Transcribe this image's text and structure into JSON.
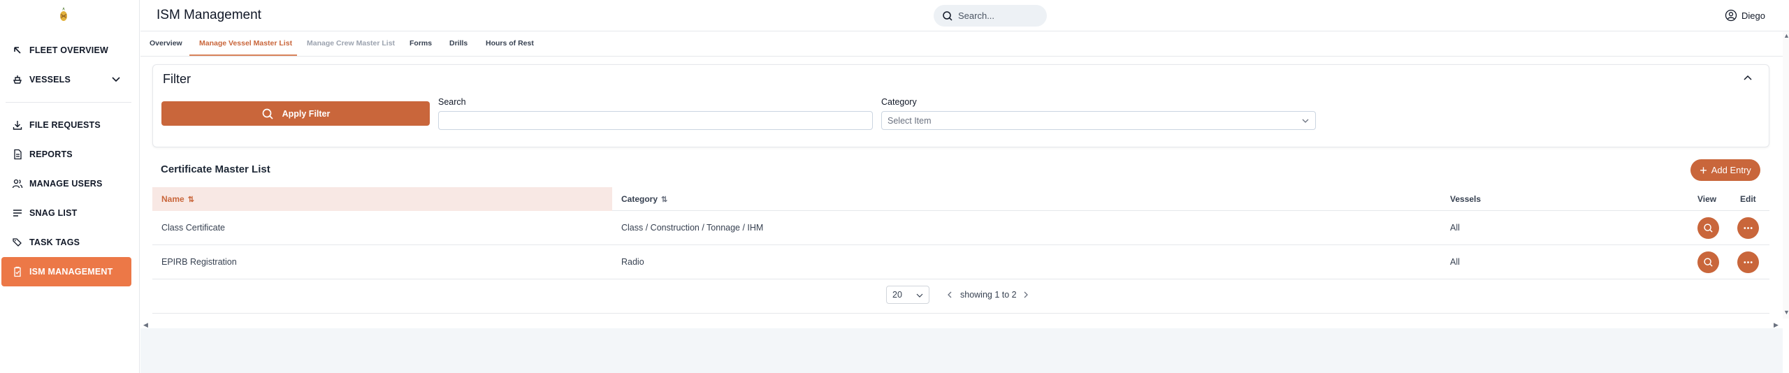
{
  "sidebar": {
    "logo": "pineapple-logo",
    "items": [
      {
        "label": "FLEET OVERVIEW",
        "icon": "arrow-up-left-icon"
      },
      {
        "label": "VESSELS",
        "icon": "ship-icon"
      },
      {
        "label": "FILE REQUESTS",
        "icon": "download-icon"
      },
      {
        "label": "REPORTS",
        "icon": "document-icon"
      },
      {
        "label": "MANAGE USERS",
        "icon": "users-icon"
      },
      {
        "label": "SNAG LIST",
        "icon": "list-icon"
      },
      {
        "label": "TASK TAGS",
        "icon": "tags-icon"
      },
      {
        "label": "ISM MANAGEMENT",
        "icon": "clipboard-check-icon"
      }
    ],
    "active_index": 7
  },
  "header": {
    "title": "ISM Management",
    "search_placeholder": "Search...",
    "user_name": "Diego"
  },
  "tabs": [
    {
      "label": "Overview",
      "state": "normal"
    },
    {
      "label": "Manage Vessel Master List",
      "state": "active"
    },
    {
      "label": "Manage Crew Master List",
      "state": "muted"
    },
    {
      "label": "Forms",
      "state": "normal"
    },
    {
      "label": "Drills",
      "state": "normal"
    },
    {
      "label": "Hours of Rest",
      "state": "normal"
    }
  ],
  "filter": {
    "title": "Filter",
    "apply_label": "Apply Filter",
    "search_label": "Search",
    "search_value": "",
    "category_label": "Category",
    "category_placeholder": "Select Item"
  },
  "list": {
    "title": "Certificate Master List",
    "add_label": "Add Entry",
    "columns": {
      "name": "Name",
      "category": "Category",
      "vessels": "Vessels",
      "view": "View",
      "edit": "Edit"
    },
    "rows": [
      {
        "name": "Class Certificate",
        "category": "Class / Construction / Tonnage / IHM",
        "vessels": "All"
      },
      {
        "name": "EPIRB Registration",
        "category": "Radio",
        "vessels": "All"
      }
    ]
  },
  "pagination": {
    "page_size": "20",
    "showing": "showing 1 to 2"
  },
  "colors": {
    "accent": "#c9663b",
    "active_nav": "#ec7847",
    "header_highlight": "#f8e8e4"
  }
}
